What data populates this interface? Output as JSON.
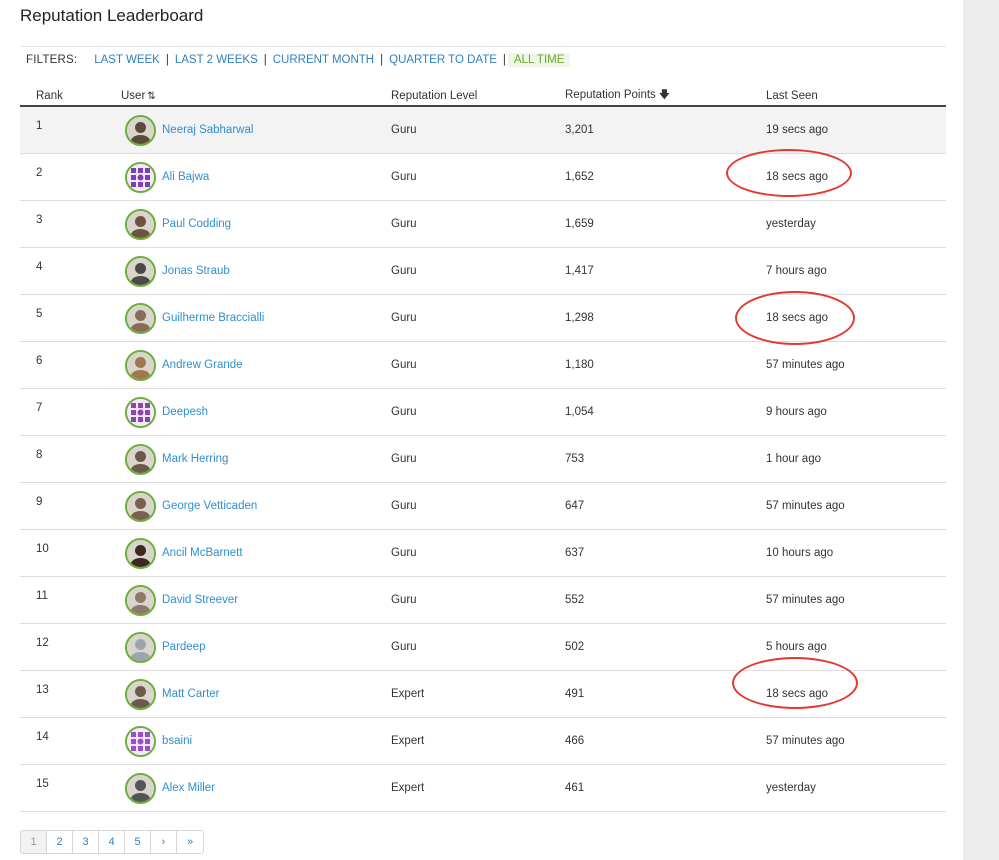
{
  "title": "Reputation Leaderboard",
  "filters": {
    "label": "FILTERS:",
    "items": [
      "LAST WEEK",
      "LAST 2 WEEKS",
      "CURRENT MONTH",
      "QUARTER TO DATE",
      "ALL TIME"
    ],
    "active": "ALL TIME"
  },
  "columns": {
    "rank": "Rank",
    "user": "User",
    "level": "Reputation Level",
    "points": "Reputation Points",
    "seen": "Last Seen"
  },
  "rows": [
    {
      "rank": "1",
      "user": "Neeraj Sabharwal",
      "level": "Guru",
      "points": "3,201",
      "seen": "19 secs ago",
      "avatar": "photo"
    },
    {
      "rank": "2",
      "user": "Ali Bajwa",
      "level": "Guru",
      "points": "1,652",
      "seen": "18 secs ago",
      "avatar": "pattern"
    },
    {
      "rank": "3",
      "user": "Paul Codding",
      "level": "Guru",
      "points": "1,659",
      "seen": "yesterday",
      "avatar": "photo"
    },
    {
      "rank": "4",
      "user": "Jonas Straub",
      "level": "Guru",
      "points": "1,417",
      "seen": "7 hours ago",
      "avatar": "photo"
    },
    {
      "rank": "5",
      "user": "Guilherme Braccialli",
      "level": "Guru",
      "points": "1,298",
      "seen": "18 secs ago",
      "avatar": "photo"
    },
    {
      "rank": "6",
      "user": "Andrew Grande",
      "level": "Guru",
      "points": "1,180",
      "seen": "57 minutes ago",
      "avatar": "photo"
    },
    {
      "rank": "7",
      "user": "Deepesh",
      "level": "Guru",
      "points": "1,054",
      "seen": "9 hours ago",
      "avatar": "pattern"
    },
    {
      "rank": "8",
      "user": "Mark Herring",
      "level": "Guru",
      "points": "753",
      "seen": "1 hour ago",
      "avatar": "photo"
    },
    {
      "rank": "9",
      "user": "George Vetticaden",
      "level": "Guru",
      "points": "647",
      "seen": "57 minutes ago",
      "avatar": "photo"
    },
    {
      "rank": "10",
      "user": "Ancil McBarnett",
      "level": "Guru",
      "points": "637",
      "seen": "10 hours ago",
      "avatar": "photo"
    },
    {
      "rank": "11",
      "user": "David Streever",
      "level": "Guru",
      "points": "552",
      "seen": "57 minutes ago",
      "avatar": "photo"
    },
    {
      "rank": "12",
      "user": "Pardeep",
      "level": "Guru",
      "points": "502",
      "seen": "5 hours ago",
      "avatar": "photo"
    },
    {
      "rank": "13",
      "user": "Matt Carter",
      "level": "Expert",
      "points": "491",
      "seen": "18 secs ago",
      "avatar": "photo"
    },
    {
      "rank": "14",
      "user": "bsaini",
      "level": "Expert",
      "points": "466",
      "seen": "57 minutes ago",
      "avatar": "pattern"
    },
    {
      "rank": "15",
      "user": "Alex Miller",
      "level": "Expert",
      "points": "461",
      "seen": "yesterday",
      "avatar": "photo"
    }
  ],
  "pagination": {
    "pages": [
      "1",
      "2",
      "3",
      "4",
      "5"
    ],
    "next": "›",
    "last": "»",
    "current": "1"
  },
  "colors": {
    "link": "#2f8fcf",
    "active_filter": "#6aa92f",
    "avatar_border": "#6aaf3a",
    "annotation": "#e33a30"
  }
}
